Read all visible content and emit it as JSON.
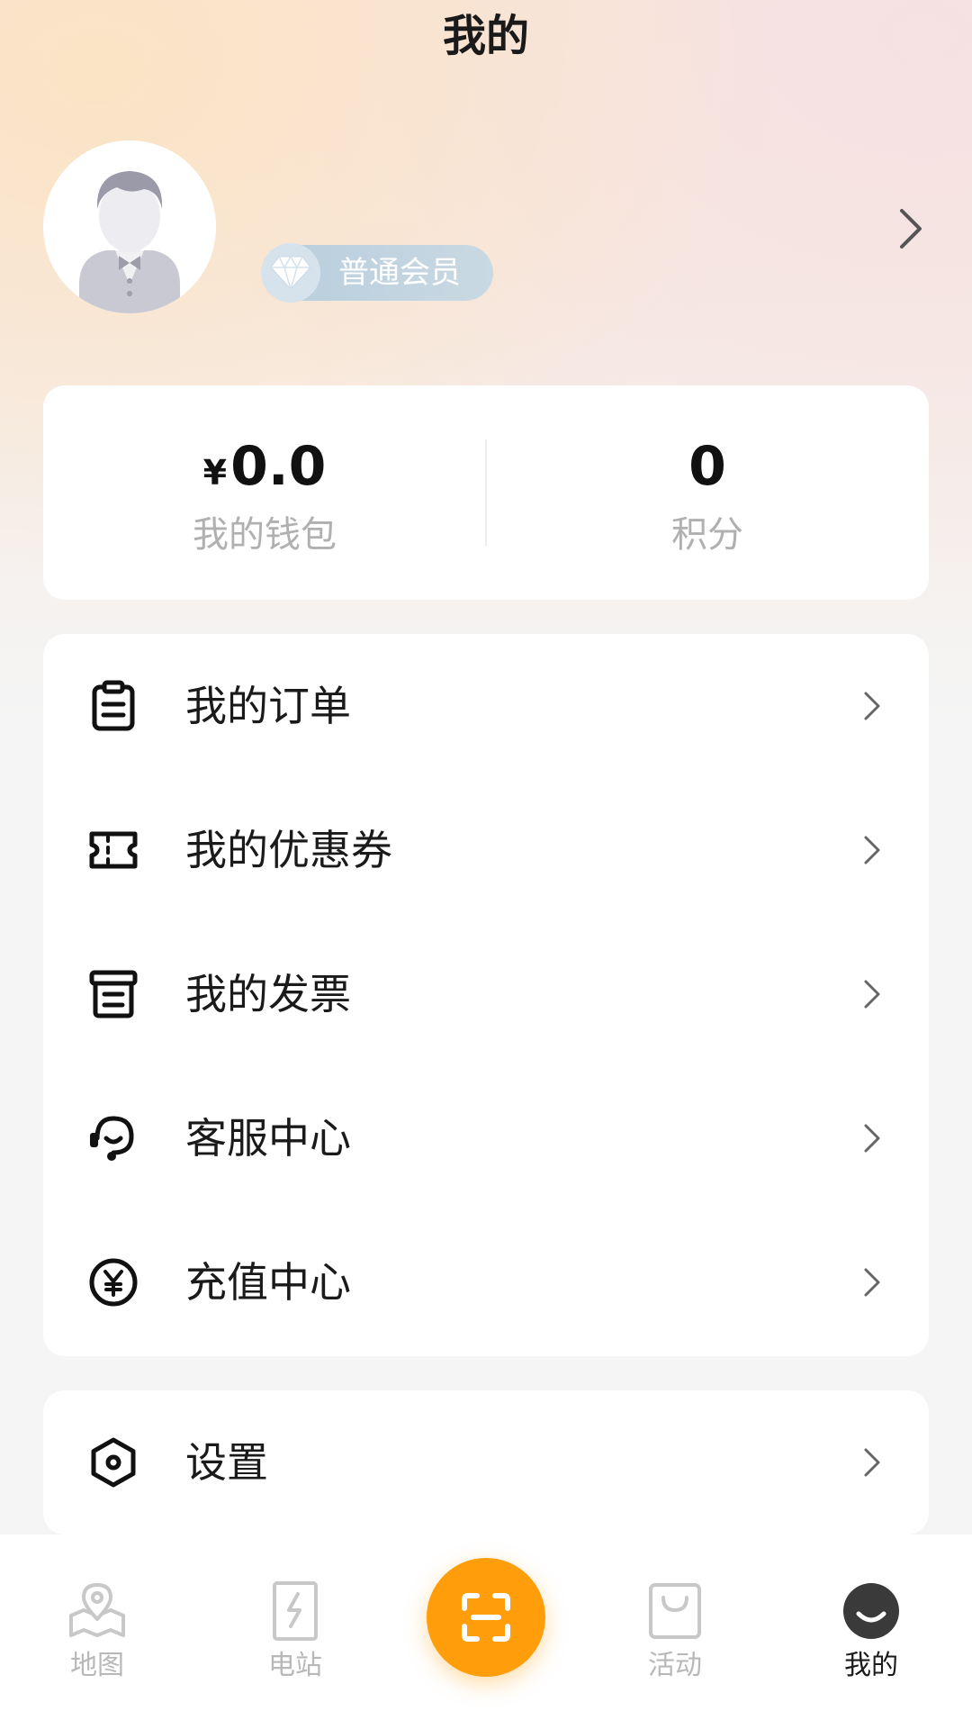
{
  "header": {
    "title": "我的"
  },
  "profile": {
    "member_level": "普通会员"
  },
  "wallet": {
    "currency_symbol": "¥",
    "balance": "0.0",
    "balance_label": "我的钱包",
    "points": "0",
    "points_label": "积分"
  },
  "menu": {
    "items": [
      {
        "label": "我的订单",
        "icon": "clipboard-icon"
      },
      {
        "label": "我的优惠券",
        "icon": "ticket-icon"
      },
      {
        "label": "我的发票",
        "icon": "invoice-box-icon"
      },
      {
        "label": "客服中心",
        "icon": "headset-icon"
      },
      {
        "label": "充值中心",
        "icon": "yen-circle-icon"
      }
    ]
  },
  "settings": {
    "label": "设置",
    "icon": "gear-hexagon-icon"
  },
  "tabbar": {
    "tabs": [
      {
        "label": "地图",
        "icon": "map-pin-icon",
        "active": false
      },
      {
        "label": "电站",
        "icon": "charging-station-icon",
        "active": false
      },
      {
        "label": "",
        "icon": "scan-icon",
        "active": false
      },
      {
        "label": "活动",
        "icon": "shopping-bag-icon",
        "active": false
      },
      {
        "label": "我的",
        "icon": "smiley-face-icon",
        "active": true
      }
    ]
  },
  "colors": {
    "accent": "#ff9d0b",
    "text_primary": "#1a1a1a",
    "text_muted": "#b0b0b0",
    "member_badge": "#b8cddc"
  }
}
